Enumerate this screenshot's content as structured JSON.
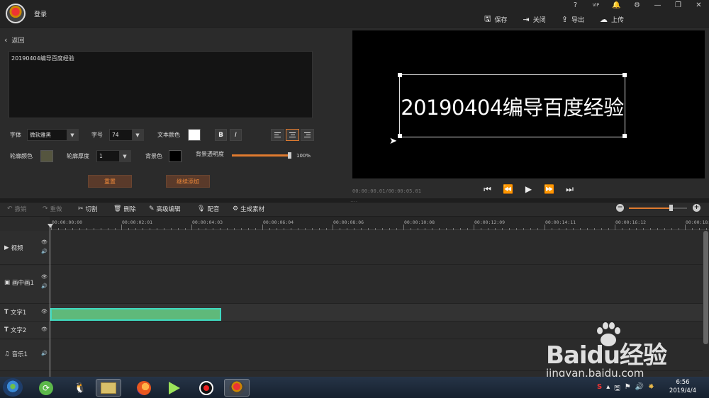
{
  "titlebar": {
    "login": "登录",
    "sys": [
      "?",
      "VIP",
      "🔔",
      "⚙",
      "—",
      "❐",
      "✕"
    ],
    "actions": {
      "save": "保存",
      "close": "关闭",
      "export": "导出",
      "upload": "上传"
    }
  },
  "editor": {
    "back": "返回",
    "text": "20190404编导百度经验",
    "font_label": "字体",
    "font_value": "微软雅黑",
    "size_label": "字号",
    "size_value": "74",
    "color_label": "文本颜色",
    "text_color": "#ffffff",
    "bold": "B",
    "italic": "I",
    "outline_color_label": "轮廓颜色",
    "outline_color": "#55553f",
    "outline_width_label": "轮廓厚度",
    "outline_width_value": "1",
    "bg_color_label": "背景色",
    "bg_color": "#000000",
    "bg_opacity_label": "背景透明度",
    "bg_opacity_value": "100%",
    "bg_opacity": 100,
    "reset": "重置",
    "continue_add": "继续添加"
  },
  "preview": {
    "caption": "20190404编导百度经验",
    "timecode": "00:00:00.01/00:00:05.01",
    "controls": [
      "⏮",
      "⏪",
      "▶",
      "⏩",
      "⏭"
    ]
  },
  "edit_toolbar": {
    "undo": "撤销",
    "redo": "重做",
    "cut": "切割",
    "delete": "删除",
    "advanced": "高级编辑",
    "dub": "配音",
    "generate": "生成素材"
  },
  "timeline": {
    "ticks": [
      "00:00:00:00",
      "00:00:02:01",
      "00:00:04:03",
      "00:00:06:04",
      "00:00:08:06",
      "00:00:10:08",
      "00:00:12:09",
      "00:00:14:11",
      "00:00:16:12",
      "00:00:18:"
    ],
    "tracks": [
      {
        "name": "视频",
        "icon": "▶"
      },
      {
        "name": "画中画1",
        "icon": "▣"
      },
      {
        "name": "文字1",
        "icon": "T"
      },
      {
        "name": "文字2",
        "icon": "T"
      },
      {
        "name": "音乐1",
        "icon": "♫"
      }
    ],
    "zoom_level": 0.73
  },
  "taskbar": {
    "time": "6:56",
    "date": "2019/4/4"
  },
  "watermark": {
    "brand": "Baidu经验",
    "url": "jingyan.baidu.com"
  }
}
